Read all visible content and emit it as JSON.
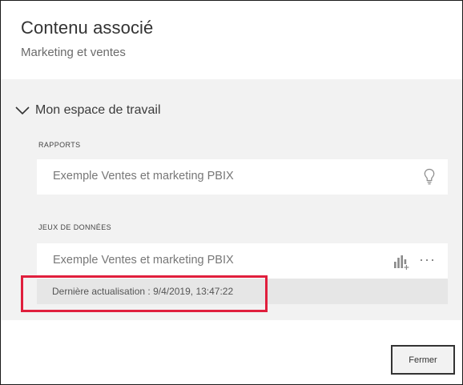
{
  "dialog": {
    "title": "Contenu associé",
    "subtitle": "Marketing et ventes"
  },
  "workspace": {
    "label": "Mon espace de travail",
    "expanded": true,
    "icon": "chevron-down-icon"
  },
  "reports": {
    "section_label": "RAPPORTS",
    "items": [
      {
        "name": "Exemple Ventes et marketing PBIX",
        "icon": "lightbulb-icon"
      }
    ]
  },
  "datasets": {
    "section_label": "JEUX DE DONNÉES",
    "items": [
      {
        "name": "Exemple Ventes et marketing PBIX",
        "icons": [
          "create-report-icon",
          "more-options-icon"
        ],
        "last_refresh": "Dernière actualisation : 9/4/2019, 13:47:22"
      }
    ]
  },
  "footer": {
    "close_label": "Fermer"
  },
  "colors": {
    "highlight": "#e01f3d",
    "panel_bg": "#f2f2f2",
    "refresh_bg": "#e6e6e6"
  }
}
